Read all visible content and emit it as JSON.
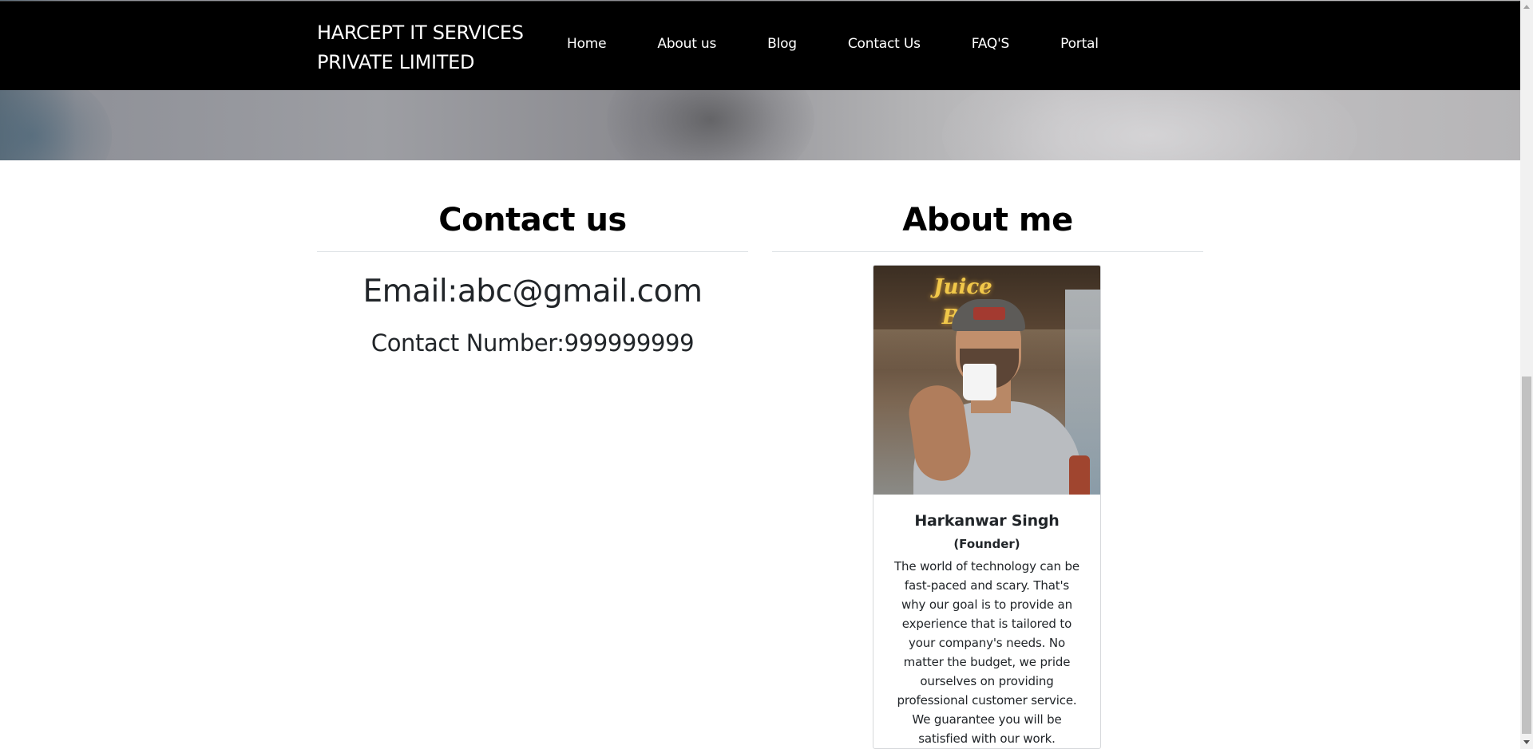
{
  "navbar": {
    "brand_line1": "HARCEPT IT SERVICES",
    "brand_line2": "PRIVATE LIMITED",
    "items": [
      {
        "label": "Home"
      },
      {
        "label": "About us"
      },
      {
        "label": "Blog"
      },
      {
        "label": "Contact Us"
      },
      {
        "label": "FAQ'S"
      },
      {
        "label": "Portal"
      }
    ]
  },
  "contact": {
    "title": "Contact us",
    "email": "Email:abc@gmail.com",
    "phone": "Contact Number:999999999"
  },
  "about": {
    "title": "About me",
    "photo_sign": "Juice Bar",
    "name": "Harkanwar Singh",
    "role": "(Founder)",
    "description": "The world of technology can be fast-paced and scary. That's why our goal is to provide an experience that is tailored to your company's needs. No matter the budget, we pride ourselves on providing professional customer service. We guarantee you will be satisfied with our work."
  },
  "colors": {
    "navbar_bg": "#000000",
    "navbar_text": "#ffffff",
    "body_text": "#212529",
    "divider": "#dee2e6"
  }
}
